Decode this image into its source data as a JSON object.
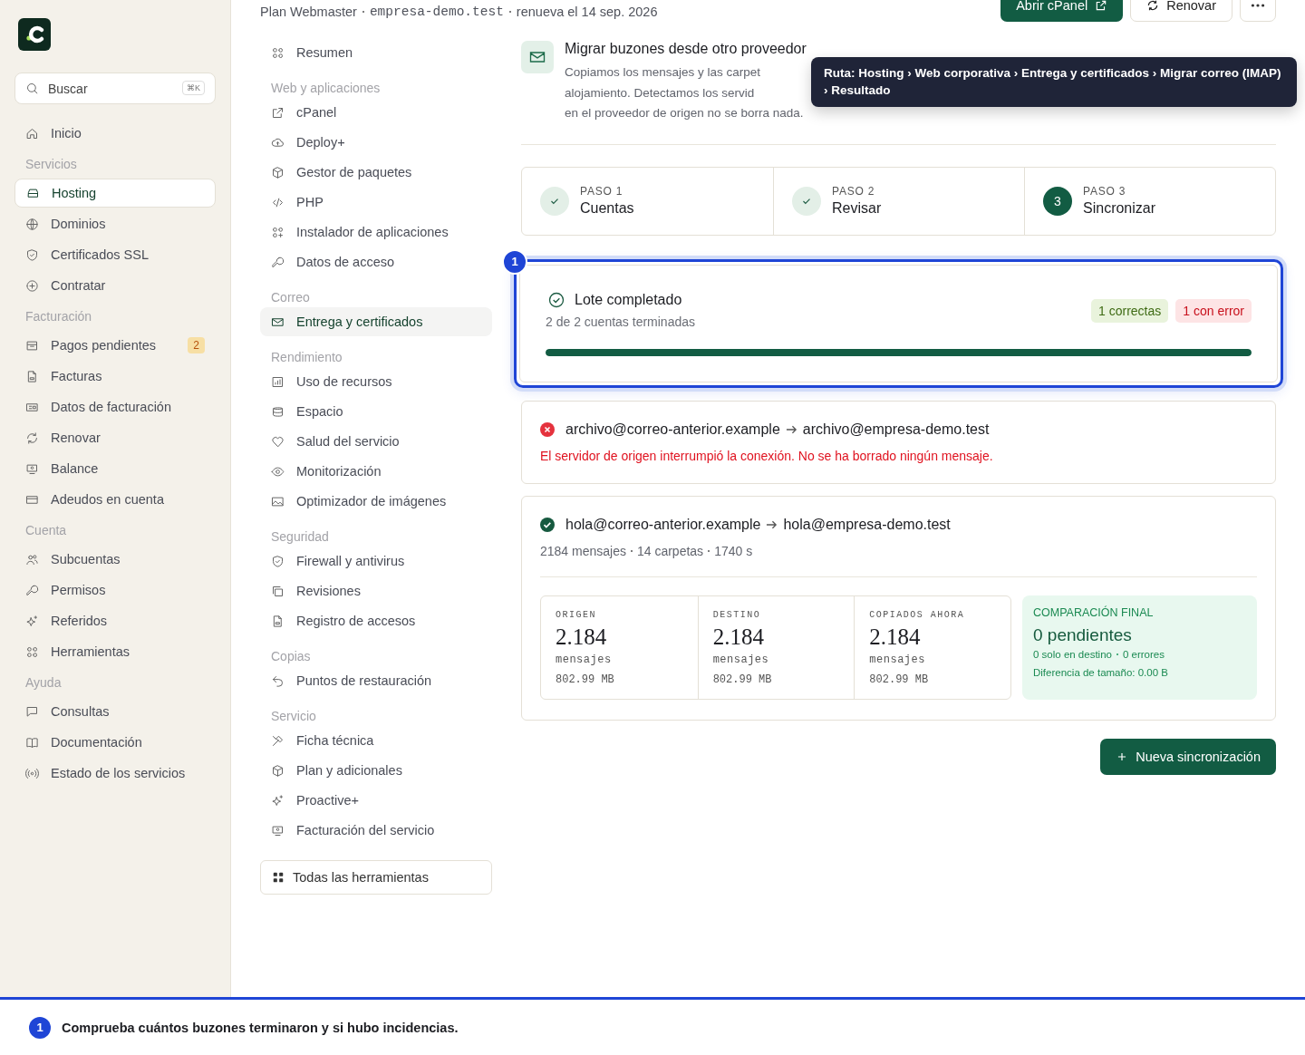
{
  "sidebar": {
    "search": {
      "placeholder": "Buscar",
      "shortcut": "⌘K"
    },
    "sections": [
      {
        "items": [
          {
            "label": "Inicio",
            "selected": false
          }
        ]
      },
      {
        "heading": "Servicios",
        "items": [
          {
            "label": "Hosting",
            "selected": true
          },
          {
            "label": "Dominios",
            "selected": false
          },
          {
            "label": "Certificados SSL",
            "selected": false
          },
          {
            "label": "Contratar",
            "selected": false
          }
        ]
      },
      {
        "heading": "Facturación",
        "items": [
          {
            "label": "Pagos pendientes",
            "selected": false,
            "badge": "2"
          },
          {
            "label": "Facturas",
            "selected": false
          },
          {
            "label": "Datos de facturación",
            "selected": false
          },
          {
            "label": "Renovar",
            "selected": false
          },
          {
            "label": "Balance",
            "selected": false
          },
          {
            "label": "Adeudos en cuenta",
            "selected": false
          }
        ]
      },
      {
        "heading": "Cuenta",
        "items": [
          {
            "label": "Subcuentas",
            "selected": false
          },
          {
            "label": "Permisos",
            "selected": false
          },
          {
            "label": "Referidos",
            "selected": false
          },
          {
            "label": "Herramientas",
            "selected": false
          }
        ]
      },
      {
        "heading": "Ayuda",
        "items": [
          {
            "label": "Consultas",
            "selected": false
          },
          {
            "label": "Documentación",
            "selected": false
          },
          {
            "label": "Estado de los servicios",
            "selected": false
          }
        ]
      }
    ]
  },
  "header": {
    "plan": "Plan Webmaster",
    "domain": "empresa-demo.test",
    "renewal": "renueva el 14 sep. 2026",
    "buttons": [
      {
        "kind": "primary",
        "label": "Abrir cPanel"
      },
      {
        "kind": "secondary",
        "label": "Renovar"
      },
      {
        "kind": "more"
      }
    ]
  },
  "subnav": {
    "sections": [
      {
        "items": [
          {
            "label": "Resumen",
            "selected": false
          }
        ]
      },
      {
        "heading": "Web y aplicaciones",
        "items": [
          {
            "label": "cPanel",
            "selected": false
          },
          {
            "label": "Deploy+",
            "selected": false
          },
          {
            "label": "Gestor de paquetes",
            "selected": false
          },
          {
            "label": "PHP",
            "selected": false
          },
          {
            "label": "Instalador de aplicaciones",
            "selected": false
          },
          {
            "label": "Datos de acceso",
            "selected": false
          }
        ]
      },
      {
        "heading": "Correo",
        "items": [
          {
            "label": "Entrega y certificados",
            "selected": true
          }
        ]
      },
      {
        "heading": "Rendimiento",
        "items": [
          {
            "label": "Uso de recursos",
            "selected": false
          },
          {
            "label": "Espacio",
            "selected": false
          },
          {
            "label": "Salud del servicio",
            "selected": false
          },
          {
            "label": "Monitorización",
            "selected": false
          },
          {
            "label": "Optimizador de imágenes",
            "selected": false
          }
        ]
      },
      {
        "heading": "Seguridad",
        "items": [
          {
            "label": "Firewall y antivirus",
            "selected": false
          },
          {
            "label": "Revisiones",
            "selected": false
          },
          {
            "label": "Registro de accesos",
            "selected": false
          }
        ]
      },
      {
        "heading": "Copias",
        "items": [
          {
            "label": "Puntos de restauración",
            "selected": false
          }
        ]
      },
      {
        "heading": "Servicio",
        "items": [
          {
            "label": "Ficha técnica",
            "selected": false
          },
          {
            "label": "Plan y adicionales",
            "selected": false
          },
          {
            "label": "Proactive+",
            "selected": false
          },
          {
            "label": "Facturación del servicio",
            "selected": false
          }
        ]
      }
    ],
    "all_tools": "Todas las herramientas"
  },
  "intro": {
    "title": "Migrar buzones desde otro proveedor",
    "description_lines": [
      "Copiamos los mensajes y las carpet",
      "alojamiento. Detectamos los servid",
      "en el proveedor de origen no se borra nada."
    ]
  },
  "tooltip": "Ruta: Hosting › Web corporativa › Entrega y certificados › Migrar correo (IMAP) › Resultado",
  "steps": [
    {
      "label": "PASO 1",
      "title": "Cuentas",
      "completed": true
    },
    {
      "label": "PASO 2",
      "title": "Revisar",
      "completed": true
    },
    {
      "label": "PASO 3",
      "title": "Sincronizar",
      "completed": false,
      "number": "3"
    }
  ],
  "batch": {
    "marker": "1",
    "title": "Lote completado",
    "subtitle": "2 de 2 cuentas terminadas",
    "tags": [
      {
        "kind": "success",
        "text": "1 correctas"
      },
      {
        "kind": "error",
        "text": "1 con error"
      }
    ],
    "level": 1
  },
  "results": [
    {
      "kind": "error",
      "from": "archivo@correo-anterior.example",
      "to": "archivo@empresa-demo.test",
      "message": "El servidor de origen interrumpió la conexión. No se ha borrado ningún mensaje."
    },
    {
      "kind": "success",
      "from": "hola@correo-anterior.example",
      "to": "hola@empresa-demo.test",
      "meta": [
        "2184 mensajes",
        "14 carpetas",
        "1740 s"
      ],
      "stats": [
        {
          "label": "ORIGEN",
          "value": "2.184",
          "unit": "mensajes",
          "size": "802.99 MB"
        },
        {
          "label": "DESTINO",
          "value": "2.184",
          "unit": "mensajes",
          "size": "802.99 MB"
        },
        {
          "label": "COPIADOS AHORA",
          "value": "2.184",
          "unit": "mensajes",
          "size": "802.99 MB"
        }
      ],
      "comparison": {
        "label": "COMPARACIÓN FINAL",
        "title": "0 pendientes",
        "details": [
          "0 solo en destino",
          "0 errores"
        ],
        "size_diff": "Diferencia de tamaño: 0.00 B"
      }
    }
  ],
  "new_sync": "Nueva sincronización",
  "tour": {
    "step": "1",
    "text": "Comprueba cuántos buzones terminaron y si hubo incidencias."
  }
}
